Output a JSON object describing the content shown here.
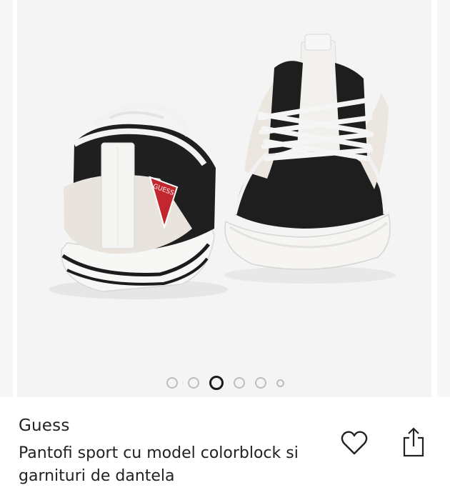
{
  "product": {
    "brand": "Guess",
    "title": "Pantofi sport cu model colorblock si garnituri de dantela"
  },
  "gallery": {
    "image_count": 6,
    "active_index": 2
  },
  "logo_text": "GUESS",
  "icons": {
    "favorite": "heart-icon",
    "share": "share-icon"
  },
  "colors": {
    "text": "#222222",
    "dot_inactive": "#bdbdbd",
    "dot_active": "#1a1a1a"
  }
}
